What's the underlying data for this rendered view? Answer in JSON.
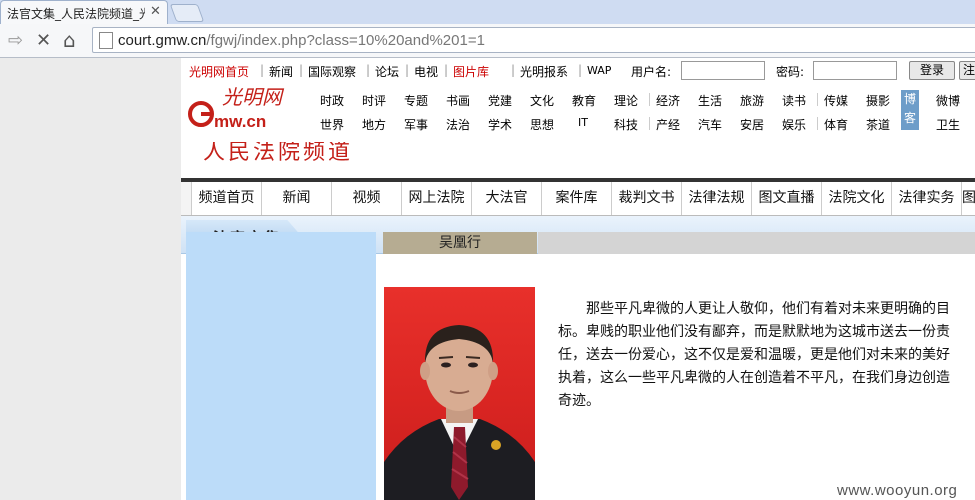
{
  "browser": {
    "tab_title": "法官文集_人民法院频道_光",
    "tab_close": "✕",
    "back_icon": "⇨",
    "stop_icon": "✕",
    "home_icon": "⌂",
    "url_domain": "court.gmw.cn",
    "url_path": "/fgwj/index.php?class=10%20and%201=1"
  },
  "topbar": {
    "links": [
      "光明网首页",
      "新闻",
      "国际观察",
      "论坛",
      "电视",
      "图片库",
      "光明报系",
      "WAP"
    ],
    "username_label": "用户名:",
    "password_label": "密码:",
    "login_button": "登录",
    "extra_button": "注"
  },
  "logo": {
    "text": "Gmw.cn",
    "chinese": "光明网"
  },
  "main_nav": {
    "row1": [
      "时政",
      "时评",
      "专题",
      "书画",
      "党建",
      "文化",
      "教育",
      "理论",
      "经济",
      "生活",
      "旅游",
      "读书",
      "传媒",
      "摄影"
    ],
    "row2": [
      "世界",
      "地方",
      "军事",
      "法治",
      "学术",
      "思想",
      "IT",
      "科技",
      "产经",
      "汽车",
      "安居",
      "娱乐",
      "体育",
      "茶道"
    ],
    "blog_label": "博客",
    "extra_row1": "微博",
    "extra_row2": "卫生"
  },
  "banner_text": "人民法院频道",
  "channel_nav": [
    "频道首页",
    "新闻",
    "视频",
    "网上法院",
    "大法官",
    "案件库",
    "裁判文书",
    "法律法规",
    "图文直播",
    "法院文化",
    "法律实务",
    "图"
  ],
  "section_title": "法官文集",
  "author_name": "吴凰行",
  "article_text": "那些平凡卑微的人更让人敬仰，他们有着对未来更明确的目标。卑贱的职业他们没有鄙弃，而是默默地为这城市送去一份责任，送去一份爱心，这不仅是爱和温暖，更是他们对未来的美好执着，这么一些平凡卑微的人在创造着不平凡，在我们身边创造奇迹。",
  "watermark": "www.wooyun.org",
  "colors": {
    "brand_red": "#c00",
    "nav_blue": "#bcdcf9",
    "name_bar": "#b6ac92"
  }
}
